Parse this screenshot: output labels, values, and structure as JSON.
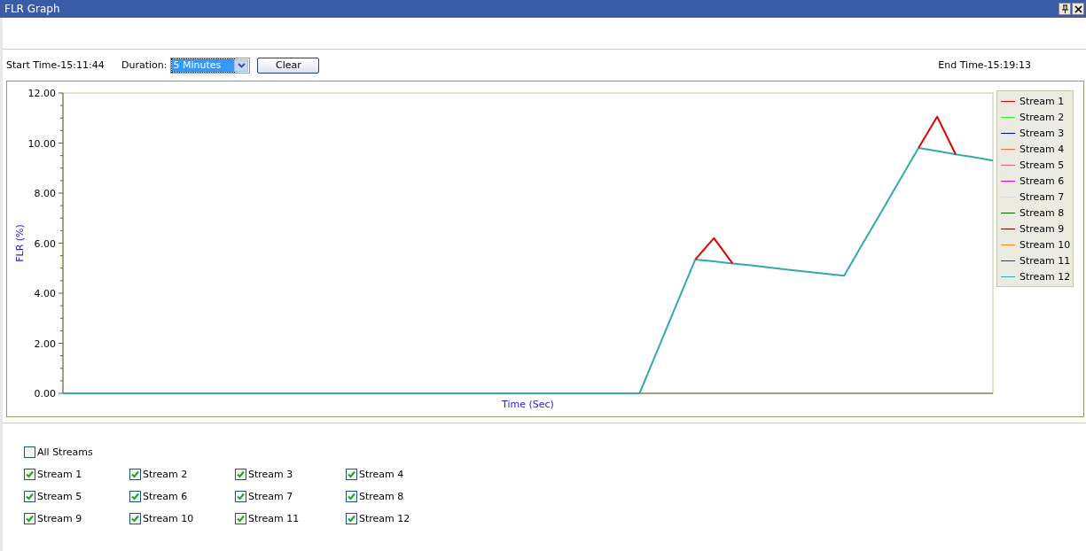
{
  "window": {
    "title": "FLR Graph"
  },
  "toolbar": {
    "start_time": "Start Time-15:11:44",
    "duration_label": "Duration:",
    "duration": {
      "value": "5 Minutes",
      "focused": true
    },
    "clear_button": "Clear",
    "end_time": "End Time-15:19:13"
  },
  "chart": {
    "chart_data": {
      "type": "line",
      "xlabel": "Time (Sec)",
      "ylabel": "FLR (%)",
      "categories": [
        null,
        null,
        null,
        null,
        null,
        null,
        null,
        null,
        null,
        null,
        null,
        null,
        null,
        null,
        null,
        null,
        null,
        null,
        null,
        null,
        null,
        null,
        null,
        null,
        null,
        null,
        null,
        null,
        null,
        null,
        null,
        null,
        null,
        null,
        null,
        null,
        null,
        null,
        null,
        null,
        null,
        null,
        null,
        null,
        null,
        null,
        null,
        null,
        null,
        null,
        null
      ],
      "ylim": [
        0,
        12
      ],
      "yticks": [
        {
          "value": 0,
          "label": "0.00"
        },
        {
          "value": 2,
          "label": "2.00"
        },
        {
          "value": 4,
          "label": "4.00"
        },
        {
          "value": 6,
          "label": "6.00"
        },
        {
          "value": 8,
          "label": "8.00"
        },
        {
          "value": 10,
          "label": "10.00"
        },
        {
          "value": 12,
          "label": "12.00"
        }
      ],
      "series": [
        {
          "color": "#e00000",
          "values": [
            null,
            null,
            null,
            null,
            null,
            null,
            null,
            null,
            null,
            null,
            null,
            null,
            null,
            null,
            null,
            null,
            null,
            null,
            null,
            null,
            null,
            null,
            null,
            null,
            null,
            null,
            null,
            null,
            null,
            null,
            null,
            null,
            null,
            null,
            5.35,
            6.2,
            5.19,
            null,
            null,
            null,
            null,
            null,
            null,
            null,
            null,
            null,
            9.8,
            11.05,
            9.55,
            null,
            null
          ]
        },
        {
          "color": "#33aaaa",
          "values": [
            0,
            0,
            0,
            0,
            0,
            0,
            0,
            0,
            0,
            0,
            0,
            0,
            0,
            0,
            0,
            0,
            0,
            0,
            0,
            0,
            0,
            0,
            0,
            0,
            0,
            0,
            0,
            0,
            0,
            0,
            0,
            0,
            1.78,
            3.57,
            5.35,
            5.27,
            5.19,
            5.11,
            5.03,
            4.94,
            4.86,
            4.78,
            4.7,
            5.98,
            7.25,
            8.53,
            9.8,
            9.68,
            9.55,
            9.43,
            9.3
          ]
        }
      ]
    },
    "legend": [
      {
        "label": "Stream 1",
        "color": "#e00000"
      },
      {
        "label": "Stream 2",
        "color": "#33ee33"
      },
      {
        "label": "Stream 3",
        "color": "#0000cc"
      },
      {
        "label": "Stream 4",
        "color": "#ff6644"
      },
      {
        "label": "Stream 5",
        "color": "#dd6680"
      },
      {
        "label": "Stream 6",
        "color": "#ee00ee"
      },
      {
        "label": "Stream 7",
        "color": "#d8d8e4"
      },
      {
        "label": "Stream 8",
        "color": "#006600"
      },
      {
        "label": "Stream 9",
        "color": "#800000"
      },
      {
        "label": "Stream 10",
        "color": "#ff8822"
      },
      {
        "label": "Stream 11",
        "color": "#334455"
      },
      {
        "label": "Stream 12",
        "color": "#33aaaa"
      }
    ]
  },
  "all_streams": {
    "label": "All Streams",
    "checked": false
  },
  "streams": [
    {
      "label": "Stream 1",
      "checked": true
    },
    {
      "label": "Stream 2",
      "checked": true
    },
    {
      "label": "Stream 3",
      "checked": true
    },
    {
      "label": "Stream 4",
      "checked": true
    },
    {
      "label": "Stream 5",
      "checked": true
    },
    {
      "label": "Stream 6",
      "checked": true
    },
    {
      "label": "Stream 7",
      "checked": true
    },
    {
      "label": "Stream 8",
      "checked": true
    },
    {
      "label": "Stream 9",
      "checked": true
    },
    {
      "label": "Stream 10",
      "checked": true
    },
    {
      "label": "Stream 11",
      "checked": true
    },
    {
      "label": "Stream 12",
      "checked": true
    }
  ]
}
